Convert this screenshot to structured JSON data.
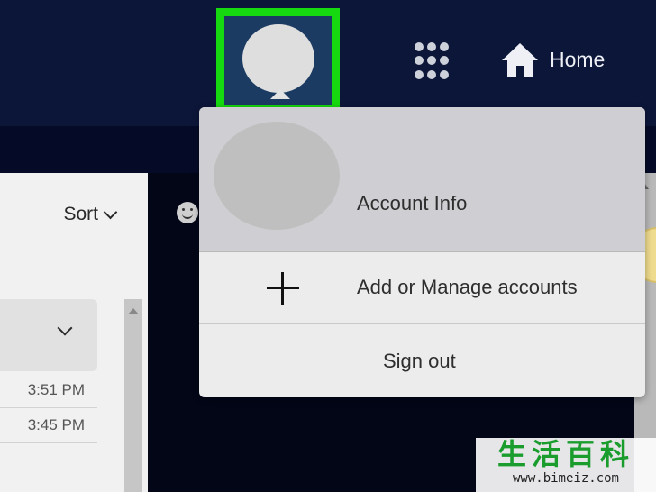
{
  "header": {
    "home_label": "Home",
    "account_icon": "avatar-circle",
    "apps_icon": "app-launcher-grid",
    "home_icon": "house",
    "highlight_color": "#16d90f"
  },
  "email_pane": {
    "sort_label": "Sort",
    "messages": [
      {
        "time": "3:51 PM"
      },
      {
        "time": "3:45 PM"
      }
    ]
  },
  "account_menu": {
    "account_info_label": "Account Info",
    "add_manage_label": "Add or Manage accounts",
    "sign_out_label": "Sign out"
  },
  "watermark": {
    "title": "生活百科",
    "url": "www.bimeiz.com"
  }
}
